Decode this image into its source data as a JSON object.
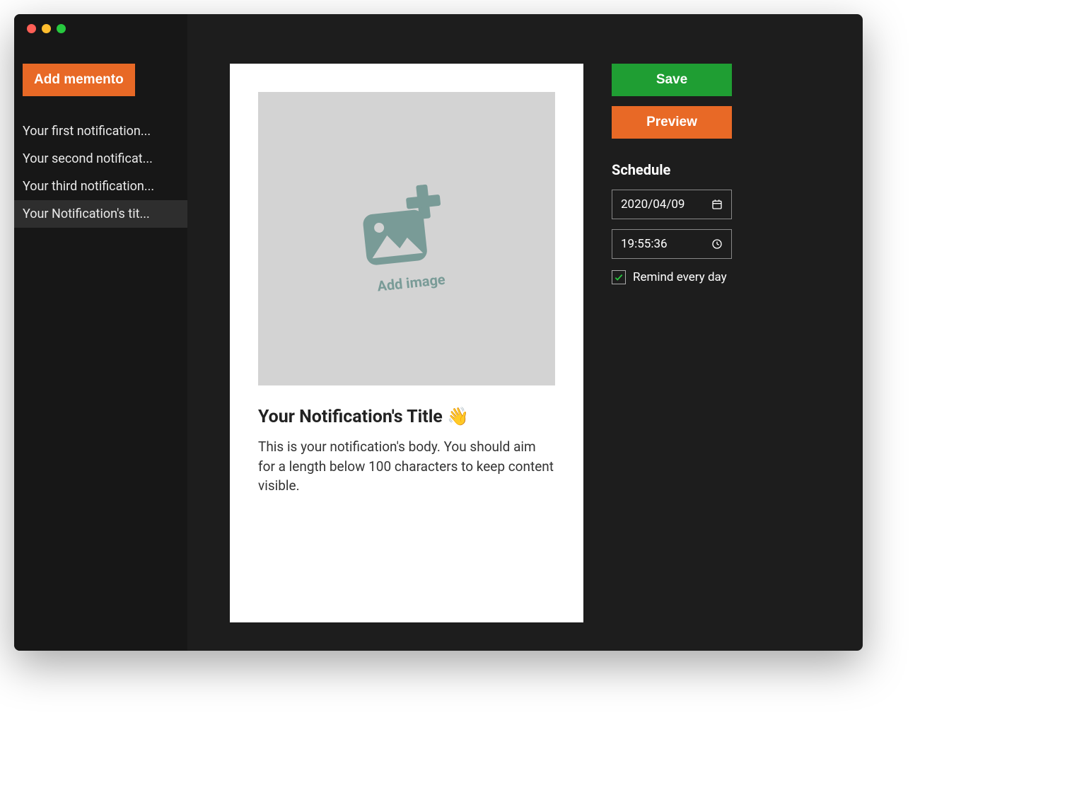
{
  "sidebar": {
    "add_label": "Add memento",
    "items": [
      {
        "label": "Your first notification...",
        "active": false
      },
      {
        "label": "Your second notificat...",
        "active": false
      },
      {
        "label": "Your third notification...",
        "active": false
      },
      {
        "label": "Your Notification's tit...",
        "active": true
      }
    ]
  },
  "editor": {
    "image_placeholder_label": "Add image",
    "title": "Your Notification's Title 👋",
    "body": "This is your notification's body. You should aim for a length below 100 characters to keep content visible."
  },
  "actions": {
    "save_label": "Save",
    "preview_label": "Preview"
  },
  "schedule": {
    "heading": "Schedule",
    "date_value": "2020/04/09",
    "time_value": "19:55:36",
    "repeat_label": "Remind every day",
    "repeat_checked": true
  },
  "colors": {
    "accent_orange": "#e86926",
    "accent_green": "#1f9e33",
    "bg_dark": "#1d1d1d",
    "sidebar_bg": "#171717"
  }
}
